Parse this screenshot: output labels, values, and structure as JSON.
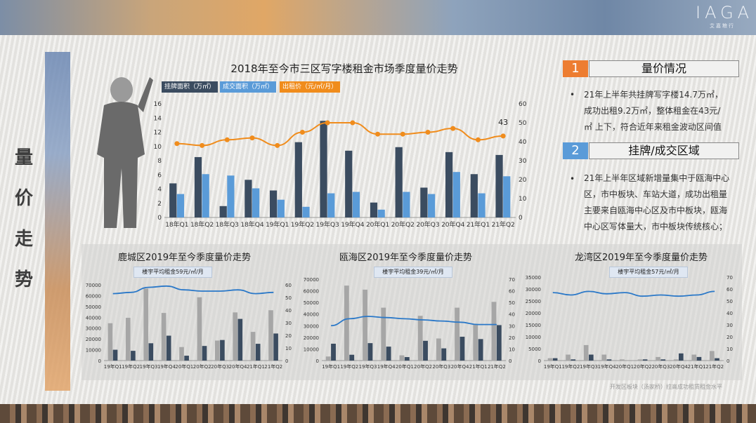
{
  "brand": {
    "name": "IAGA",
    "sub": "艾嘉粮行"
  },
  "side_title": [
    "量",
    "价",
    "走",
    "势"
  ],
  "main_chart_title": "2018年至今市三区写字楼租金市场季度量价走势",
  "legend": {
    "listing": "挂牌面积（万㎡）",
    "deal": "成交面积（万㎡）",
    "rent": "出租价（元/㎡/月）"
  },
  "colors": {
    "listing": "#3b4c60",
    "deal": "#5a9bd8",
    "rent": "#f08c1c",
    "gray": "#a6a6a6",
    "dark": "#3b4c60",
    "line": "#2a78c8",
    "num": "#ed7d31",
    "numblue": "#5a9bd8"
  },
  "sections": [
    {
      "num": "1",
      "title": "量价情况",
      "text": "21年上半年共挂牌写字楼14.7万㎡，成功出租9.2万㎡，整体租金在43元/㎡ 上下，符合近年来租金波动区间值"
    },
    {
      "num": "2",
      "title": "挂牌/成交区域",
      "text": "21年上半年区域新增量集中于瓯海中心区，市中板块、车站大道，成功出租量主要来自瓯海中心区及市中板块，瓯海中心区写体量大，市中板块传统核心；"
    }
  ],
  "section_lines": [
    [
      "21年上半年共挂牌写字楼14.7万㎡，",
      "成功出租9.2万㎡，整体租金在43元/",
      "㎡ 上下，符合近年来租金波动区间值"
    ],
    [
      "21年上半年区域新增量集中于瓯海中心",
      "区，市中板块、车站大道，成功出租量",
      "主要来自瓯海中心区及市中板块，瓯海",
      "中心区写体量大，市中板块传统核心；"
    ]
  ],
  "chart_data": [
    {
      "type": "bar",
      "title": "2018年至今市三区写字楼租金市场季度量价走势",
      "categories": [
        "18年Q1",
        "18年Q2",
        "18年Q3",
        "18年Q4",
        "19年Q1",
        "19年Q2",
        "19年Q3",
        "19年Q4",
        "20年Q1",
        "20年Q2",
        "20年Q3",
        "20年Q4",
        "21年Q1",
        "21年Q2"
      ],
      "series": [
        {
          "name": "挂牌面积（万㎡）",
          "axis": "left",
          "values": [
            4.8,
            8.5,
            1.6,
            5.3,
            3.8,
            10.6,
            13.6,
            9.4,
            2.1,
            9.9,
            4.2,
            9.2,
            6.1,
            8.8
          ]
        },
        {
          "name": "成交面积（万㎡）",
          "axis": "left",
          "values": [
            3.3,
            6.1,
            5.9,
            4.1,
            2.5,
            1.5,
            3.4,
            3.6,
            1.1,
            3.6,
            3.3,
            6.4,
            3.4,
            5.8
          ]
        },
        {
          "name": "出租价（元/㎡/月）",
          "type": "line",
          "axis": "right",
          "values": [
            39,
            38,
            41,
            42,
            38,
            45,
            50,
            50,
            44,
            44,
            45,
            47,
            41,
            43
          ]
        }
      ],
      "ylim_left": [
        0,
        16
      ],
      "yticks_left": [
        0,
        2,
        4,
        6,
        8,
        10,
        12,
        14,
        16
      ],
      "ylim_right": [
        0,
        60
      ],
      "yticks_right": [
        0,
        10,
        20,
        30,
        40,
        50,
        60
      ],
      "data_label": "43"
    },
    {
      "type": "bar",
      "title": "鹿城区2019年至今季度量价走势",
      "tag": "楼宇平均租金59元/㎡/月",
      "categories": [
        "19年Q1",
        "19年Q2",
        "19年Q3",
        "19年Q4",
        "20年Q1",
        "20年Q2",
        "20年Q3",
        "20年Q4",
        "21年Q1",
        "21年Q2"
      ],
      "series": [
        {
          "name": "挂牌",
          "values": [
            34500,
            39500,
            66500,
            44000,
            12500,
            58500,
            18500,
            44500,
            26500,
            46500
          ]
        },
        {
          "name": "成交",
          "values": [
            10000,
            9000,
            16000,
            23000,
            4500,
            13500,
            19000,
            38500,
            15500,
            25000
          ]
        },
        {
          "name": "租金",
          "type": "line",
          "values": [
            53,
            54,
            58,
            59,
            56,
            55,
            55,
            56,
            53,
            54
          ]
        }
      ],
      "ylim_left": [
        0,
        70000
      ],
      "yticks_left": [
        0,
        10000,
        20000,
        30000,
        40000,
        50000,
        60000,
        70000
      ],
      "ylim_right": [
        0,
        60
      ],
      "yticks_right": [
        0,
        10,
        20,
        30,
        40,
        50,
        60
      ]
    },
    {
      "type": "bar",
      "title": "瓯海区2019年至今季度量价走势",
      "tag": "楼宇平均租金39元/㎡/月",
      "categories": [
        "19年Q1",
        "19年Q2",
        "19年Q3",
        "19年Q4",
        "20年Q1",
        "20年Q2",
        "20年Q3",
        "20年Q4",
        "21年Q1",
        "21年Q2"
      ],
      "series": [
        {
          "name": "挂牌",
          "values": [
            3500,
            64500,
            61000,
            45500,
            4500,
            38500,
            19000,
            45500,
            31500,
            50500
          ]
        },
        {
          "name": "成交",
          "values": [
            14500,
            5000,
            15000,
            12000,
            3000,
            17000,
            10500,
            20500,
            18500,
            30500
          ]
        },
        {
          "name": "租金",
          "type": "line",
          "values": [
            30,
            36,
            38,
            37,
            36,
            35,
            34,
            33,
            31,
            31
          ]
        }
      ],
      "ylim_left": [
        0,
        70000
      ],
      "yticks_left": [
        0,
        10000,
        20000,
        30000,
        40000,
        50000,
        60000,
        70000
      ],
      "ylim_right": [
        0,
        70
      ],
      "yticks_right": [
        0,
        10,
        20,
        30,
        40,
        50,
        60,
        70
      ]
    },
    {
      "type": "bar",
      "title": "龙湾区2019年至今季度量价走势",
      "tag": "楼宇平均租金57元/㎡/月",
      "categories": [
        "19年Q1",
        "19年Q2",
        "19年Q3",
        "19年Q4",
        "20年Q1",
        "20年Q2",
        "20年Q3",
        "20年Q4",
        "21年Q1",
        "21年Q2"
      ],
      "series": [
        {
          "name": "挂牌",
          "values": [
            1000,
            2500,
            6500,
            2500,
            500,
            500,
            1500,
            500,
            2500,
            4000
          ]
        },
        {
          "name": "成交",
          "values": [
            1000,
            500,
            2500,
            500,
            0,
            500,
            500,
            3000,
            1500,
            1000
          ]
        },
        {
          "name": "租金",
          "type": "line",
          "values": [
            57,
            55,
            58,
            56,
            57,
            54,
            55,
            54,
            55,
            58
          ]
        }
      ],
      "ylim_left": [
        0,
        35000
      ],
      "yticks_left": [
        0,
        5000,
        10000,
        15000,
        20000,
        25000,
        30000,
        35000
      ],
      "ylim_right": [
        0,
        70
      ],
      "yticks_right": [
        0,
        10,
        20,
        30,
        40,
        50,
        60,
        70
      ]
    }
  ],
  "footnote": "开发区板块（汤家桥）拉高成功租赁租金水平"
}
